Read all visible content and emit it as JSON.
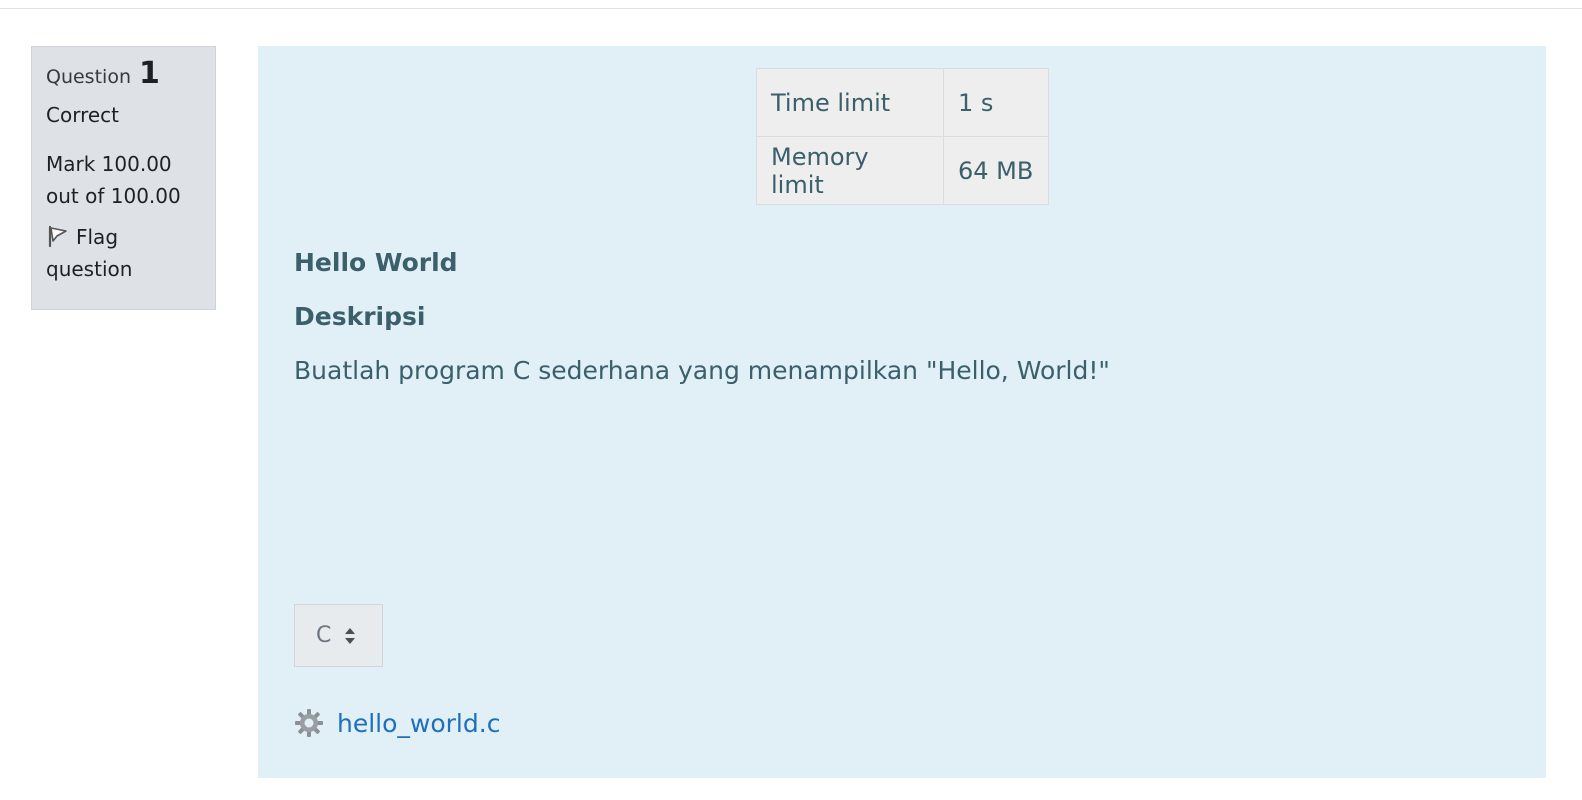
{
  "question_info": {
    "label": "Question",
    "number": "1",
    "state": "Correct",
    "grade": "Mark 100.00 out of 100.00",
    "flag_label": "Flag question"
  },
  "limits": [
    {
      "key": "Time limit",
      "value": "1 s"
    },
    {
      "key": "Memory limit",
      "value": "64 MB"
    }
  ],
  "content": {
    "title": "Hello World",
    "section_heading": "Deskripsi",
    "description": "Buatlah program C sederhana yang menampilkan \"Hello, World!\""
  },
  "language_select": {
    "selected": "C"
  },
  "attachment": {
    "filename": "hello_world.c"
  },
  "colors": {
    "panel_bg": "#e1eff7",
    "info_bg": "#dee2e6",
    "text": "#3b5f6b",
    "link": "#1f6fba"
  }
}
